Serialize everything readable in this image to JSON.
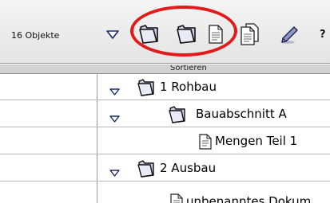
{
  "toolbar": {
    "object_count": "16 Objekte",
    "buttons": [
      {
        "name": "collapse-triangle-icon"
      },
      {
        "name": "folder-icon"
      },
      {
        "name": "folder-icon"
      },
      {
        "name": "document-icon"
      },
      {
        "name": "documents-icon"
      },
      {
        "name": "pencil-icon"
      },
      {
        "name": "help-icon",
        "label": "?"
      }
    ]
  },
  "list": {
    "sort_header": "Sortieren",
    "rows": [
      {
        "label": "1 Rohbau",
        "type": "folder",
        "expanded": true
      },
      {
        "label": "Bauabschnitt A",
        "type": "folder",
        "expanded": true
      },
      {
        "label": "Mengen Teil 1",
        "type": "document"
      },
      {
        "label": "2 Ausbau",
        "type": "folder",
        "expanded": true
      },
      {
        "label": "unbenanntes Dokum",
        "type": "document"
      }
    ]
  },
  "annotation": {
    "color": "#e11a1a"
  }
}
